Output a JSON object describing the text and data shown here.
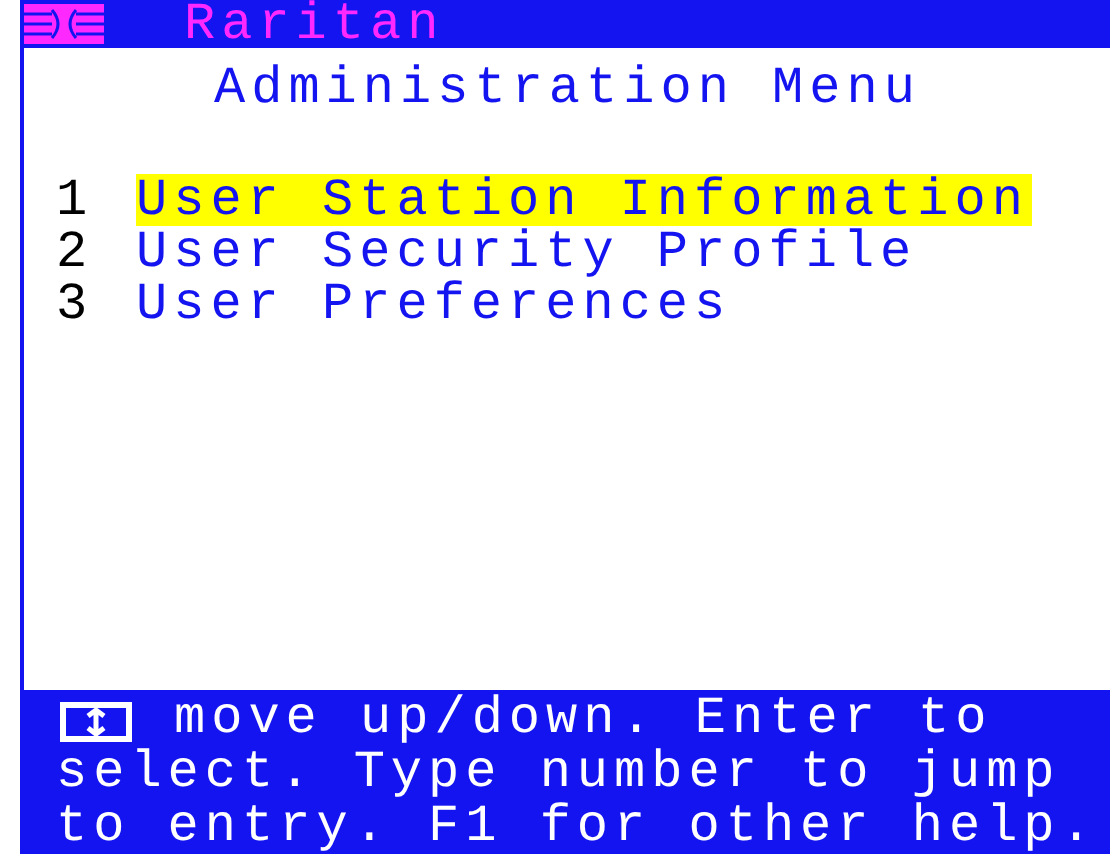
{
  "header": {
    "title": "Raritan"
  },
  "menu": {
    "title": "Administration Menu",
    "items": [
      {
        "number": "1",
        "label": "User Station Information",
        "selected": true
      },
      {
        "number": "2",
        "label": "User Security Profile",
        "selected": false
      },
      {
        "number": "3",
        "label": "User Preferences",
        "selected": false
      }
    ]
  },
  "help": {
    "lines": [
      "move up/down. Enter to",
      "select. Type number to jump",
      "to entry. F1 for other help."
    ]
  }
}
